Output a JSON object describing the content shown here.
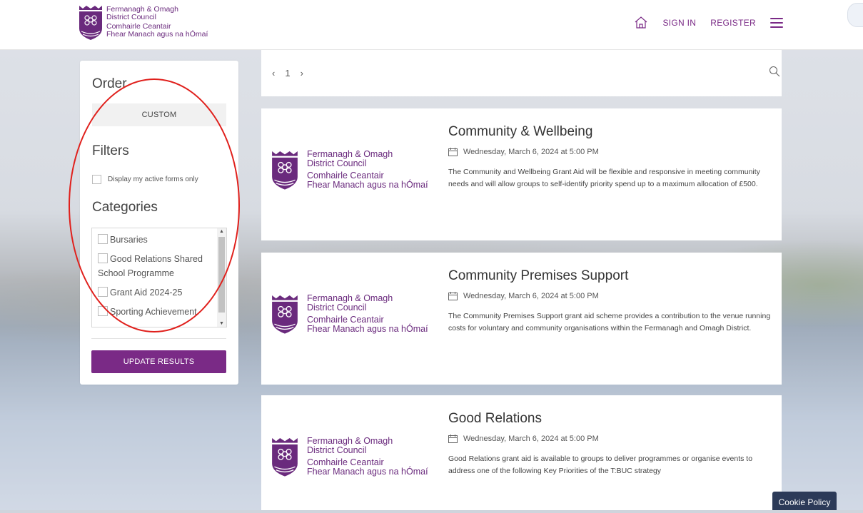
{
  "header": {
    "logo": {
      "line1": "Fermanagh & Omagh",
      "line2": "District Council",
      "line3": "Comhairle Ceantair",
      "line4": "Fhear Manach agus na hÓmaí"
    },
    "nav": {
      "sign_in": "SIGN IN",
      "register": "REGISTER",
      "home_icon": "home-icon",
      "menu_icon": "hamburger-icon"
    },
    "accent_color": "#7a2a86"
  },
  "sidebar": {
    "order_heading": "Order",
    "order_button": "CUSTOM",
    "filters_heading": "Filters",
    "filter_active_label": "Display my active forms only",
    "categories_heading": "Categories",
    "categories": [
      {
        "label": "Bursaries"
      },
      {
        "label": "Good Relations Shared School Programme"
      },
      {
        "label": "Grant Aid 2024-25"
      },
      {
        "label": "Sporting Achievement"
      }
    ],
    "update_button": "UPDATE RESULTS"
  },
  "pager": {
    "prev": "‹",
    "page": "1",
    "next": "›",
    "search_icon": "search-icon"
  },
  "cards": [
    {
      "logo_line1": "Fermanagh & Omagh",
      "logo_line2": "District Council",
      "logo_line3": "Comhairle Ceantair",
      "logo_line4": "Fhear Manach agus na hÓmaí",
      "title": "Community & Wellbeing",
      "date": "Wednesday, March 6, 2024 at 5:00 PM",
      "description": "The Community and Wellbeing Grant Aid will be flexible and responsive in meeting community needs and will allow groups to self-identify priority spend up to a maximum allocation of £500."
    },
    {
      "logo_line1": "Fermanagh & Omagh",
      "logo_line2": "District Council",
      "logo_line3": "Comhairle Ceantair",
      "logo_line4": "Fhear Manach agus na hÓmaí",
      "title": "Community Premises Support",
      "date": "Wednesday, March 6, 2024 at 5:00 PM",
      "description": "The Community Premises Support grant aid scheme provides a contribution to the venue running costs for voluntary and community organisations within the Fermanagh and Omagh District."
    },
    {
      "logo_line1": "Fermanagh & Omagh",
      "logo_line2": "District Council",
      "logo_line3": "Comhairle Ceantair",
      "logo_line4": "Fhear Manach agus na hÓmaí",
      "title": "Good Relations",
      "date": "Wednesday, March 6, 2024 at 5:00 PM",
      "description": "Good Relations grant aid is available to groups to deliver programmes or organise events to address one of the following Key Priorities of the T:BUC strategy"
    }
  ],
  "cookie_policy": "Cookie Policy"
}
